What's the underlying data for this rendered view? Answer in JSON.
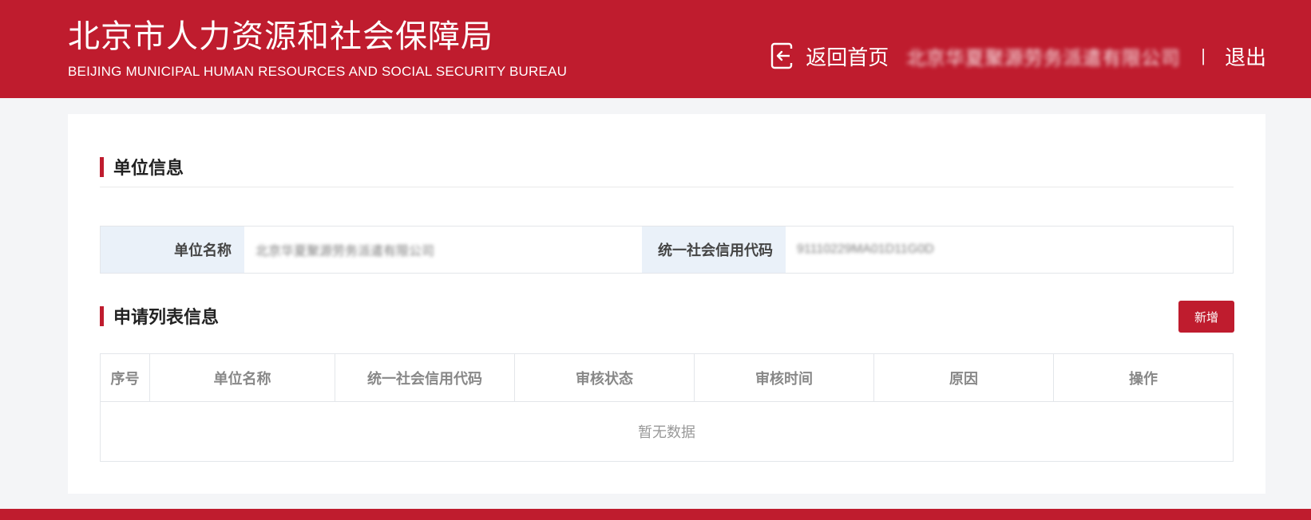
{
  "header": {
    "title_cn": "北京市人力资源和社会保障局",
    "title_en": "BEIJING MUNICIPAL HUMAN RESOURCES AND SOCIAL SECURITY BUREAU",
    "home_icon": "return-home-icon",
    "home_label": "返回首页",
    "company_name": "北京华夏聚源劳务派遣有限公司",
    "separator": "|",
    "logout_label": "退出"
  },
  "unit_info": {
    "section_title": "单位信息",
    "name_label": "单位名称",
    "name_value": "北京华夏聚源劳务派遣有限公司",
    "credit_label": "统一社会信用代码",
    "credit_value": "91110229MA01D11G0D"
  },
  "apply_list": {
    "section_title": "申请列表信息",
    "add_button": "新增",
    "columns": [
      "序号",
      "单位名称",
      "统一社会信用代码",
      "审核状态",
      "审核时间",
      "原因",
      "操作"
    ],
    "empty_text": "暂无数据"
  },
  "colors": {
    "brand": "#bf1c2e",
    "label_bg": "#eaf1f9"
  }
}
